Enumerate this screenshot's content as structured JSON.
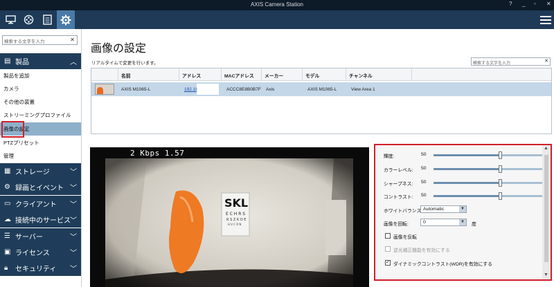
{
  "window": {
    "title": "AXIS Camera Station",
    "controls": [
      "?",
      "_",
      "▫",
      "✕"
    ]
  },
  "topbar": {
    "icons": [
      "monitor-icon",
      "film-reel-icon",
      "checklist-icon",
      "gear-icon"
    ],
    "menu_icon": "hamburger-icon"
  },
  "sidebar": {
    "search_placeholder": "検索する文字を入力",
    "section_products": "製品",
    "items": [
      "製品を追加",
      "カメラ",
      "その他の装置",
      "ストリーミングプロファイル",
      "画像の設定",
      "PTZプリセット",
      "管理"
    ],
    "active_item": "画像の設定",
    "sections": [
      "ストレージ",
      "録画とイベント",
      "クライアント",
      "接続中のサービス",
      "サーバー",
      "ライセンス",
      "セキュリティ"
    ]
  },
  "main": {
    "title": "画像の設定",
    "subtitle": "リアルタイムで変更を行います。",
    "search_placeholder": "検索する文字を入力",
    "table": {
      "headers": [
        "名前",
        "アドレス",
        "MACアドレス",
        "メーカー",
        "モデル",
        "チャンネル"
      ],
      "rows": [
        {
          "name": "AXIS M1065-L",
          "address": "192.16",
          "mac": "ACCC8E8B0B7F",
          "maker": "Axis",
          "model": "AXIS M1065-L",
          "channel": "View Area 1"
        }
      ]
    },
    "viewer": {
      "osd": "2 Kbps  1.57"
    }
  },
  "settings": {
    "brightness": {
      "label": "輝度:",
      "value": "50",
      "level": 0.5
    },
    "color_level": {
      "label": "カラーレベル:",
      "value": "50",
      "level": 0.5
    },
    "sharpness": {
      "label": "シャープネス:",
      "value": "50",
      "level": 0.5
    },
    "contrast": {
      "label": "コントラスト:",
      "value": "50",
      "level": 0.5
    },
    "white_balance": {
      "label": "ホワイトバランス:",
      "value": "Automatic"
    },
    "rotate": {
      "label": "画像を回転:",
      "value": "0",
      "unit": "度"
    },
    "flip": {
      "label": "画像を反転",
      "checked": false
    },
    "backlight": {
      "label": "逆光補正機能を有効にする",
      "checked": false,
      "disabled": true
    },
    "wdr": {
      "label": "ダイナミックコントラスト(WDR)を有効にする",
      "checked": true
    }
  },
  "colors": {
    "accent": "#d21f2a",
    "nav_dark": "#1f3d5a",
    "selection": "#8fb0cb"
  }
}
